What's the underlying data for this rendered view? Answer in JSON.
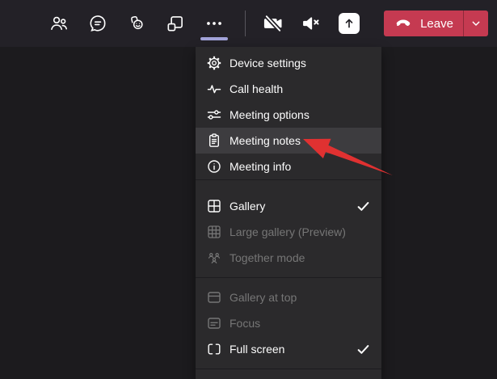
{
  "colors": {
    "topbar_bg": "#232127",
    "page_bg": "#1c1b1e",
    "menu_bg": "#2b2a2c",
    "menu_highlight": "#3d3c3f",
    "disabled_text": "#767676",
    "accent_underline": "#a2a3d9",
    "leave_red": "#c53a51",
    "arrow_red": "#e03131"
  },
  "topbar": {
    "left_buttons": [
      {
        "name": "participants",
        "icon": "people"
      },
      {
        "name": "chat",
        "icon": "chat"
      },
      {
        "name": "reactions",
        "icon": "reactions"
      },
      {
        "name": "breakout-rooms",
        "icon": "breakout-rooms"
      },
      {
        "name": "more-actions",
        "icon": "more",
        "active": true
      }
    ],
    "right_buttons": [
      {
        "name": "camera-off",
        "icon": "camera-off"
      },
      {
        "name": "audio-off",
        "icon": "speaker-muted"
      },
      {
        "name": "share-content",
        "icon": "share"
      }
    ],
    "leave": {
      "label": "Leave",
      "icon": "phone-hangup",
      "chevron_icon": "chevron-down"
    }
  },
  "menu": {
    "sections": [
      {
        "items": [
          {
            "label": "Device settings",
            "icon": "gear"
          },
          {
            "label": "Call health",
            "icon": "call-health"
          },
          {
            "label": "Meeting options",
            "icon": "meeting-options"
          },
          {
            "label": "Meeting notes",
            "icon": "meeting-notes",
            "highlighted": true
          },
          {
            "label": "Meeting info",
            "icon": "info"
          }
        ]
      },
      {
        "items": [
          {
            "label": "Gallery",
            "icon": "gallery",
            "checked": true
          },
          {
            "label": "Large gallery (Preview)",
            "icon": "large-gallery",
            "disabled": true
          },
          {
            "label": "Together mode",
            "icon": "together-mode",
            "disabled": true
          }
        ]
      },
      {
        "items": [
          {
            "label": "Gallery at top",
            "icon": "gallery-at-top",
            "disabled": true
          },
          {
            "label": "Focus",
            "icon": "focus",
            "disabled": true
          },
          {
            "label": "Full screen",
            "icon": "full-screen",
            "checked": true
          }
        ]
      }
    ]
  },
  "annotation": {
    "type": "red-arrow",
    "points_to": "Meeting notes"
  }
}
